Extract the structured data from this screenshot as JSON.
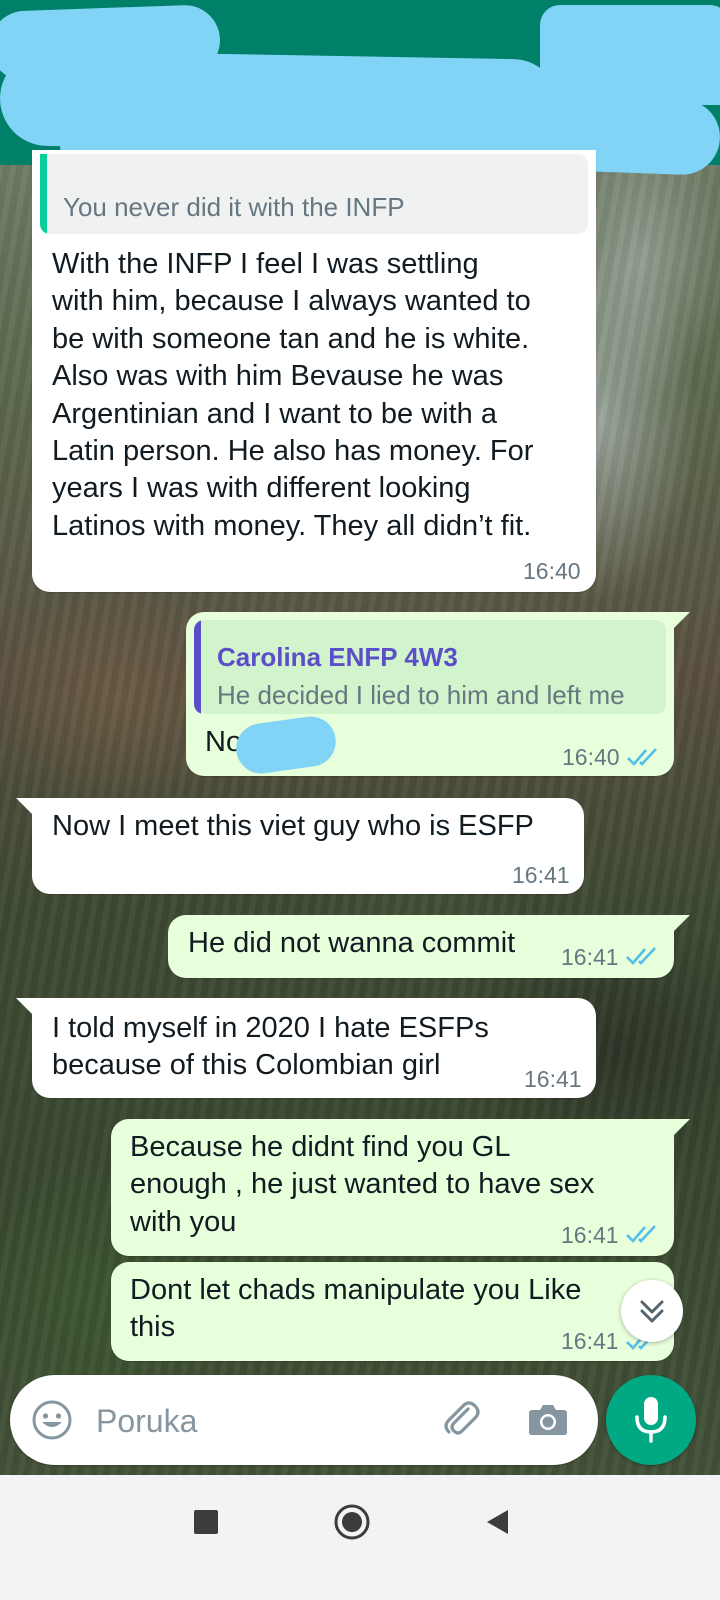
{
  "header": {
    "redacted": true
  },
  "messages": [
    {
      "direction": "incoming",
      "quote": {
        "text": "You never did it with the INFP"
      },
      "text": "With the INFP I feel I was settling\nwith him, because I always wanted to\nbe with someone tan and he is white.\nAlso was with him Bevause he was\nArgentinian and I want to be with a\nLatin person. He also has money. For\nyears I was with different looking\nLatinos with money. They all didn’t fit.",
      "time": "16:40"
    },
    {
      "direction": "outgoing",
      "quote": {
        "author": "Carolina ENFP 4W3",
        "text": "He decided I lied to him and left me"
      },
      "text": "No",
      "time": "16:40",
      "status": "read"
    },
    {
      "direction": "incoming",
      "text": "Now I meet this viet guy who is ESFP",
      "time": "16:41"
    },
    {
      "direction": "outgoing",
      "text": "He did not wanna commit",
      "time": "16:41",
      "status": "read"
    },
    {
      "direction": "incoming",
      "text": "I told myself in 2020 I hate ESFPs\nbecause of this Colombian girl",
      "time": "16:41"
    },
    {
      "direction": "outgoing",
      "text": "Because he didnt find you GL\nenough , he just wanted to have sex\nwith you",
      "time": "16:41",
      "status": "read"
    },
    {
      "direction": "outgoing",
      "text": "Dont let chads manipulate you Like\nthis",
      "time": "16:41",
      "status": "read"
    }
  ],
  "composer": {
    "placeholder": "Poruka",
    "icons": [
      "emoji-icon",
      "attach-icon",
      "camera-icon",
      "mic-icon"
    ]
  },
  "scroll_button": {
    "icon": "double-chevron-down-icon"
  },
  "navbar": {
    "icons": [
      "recents-square-icon",
      "home-circle-icon",
      "back-triangle-icon"
    ]
  },
  "colors": {
    "header": "#008069",
    "incoming_bubble": "#ffffff",
    "outgoing_bubble": "#e7ffdb",
    "quote_author": "#5b4ec8",
    "read_ticks": "#53bdeb",
    "mic_button": "#00a884",
    "redaction": "#82d4f6"
  }
}
